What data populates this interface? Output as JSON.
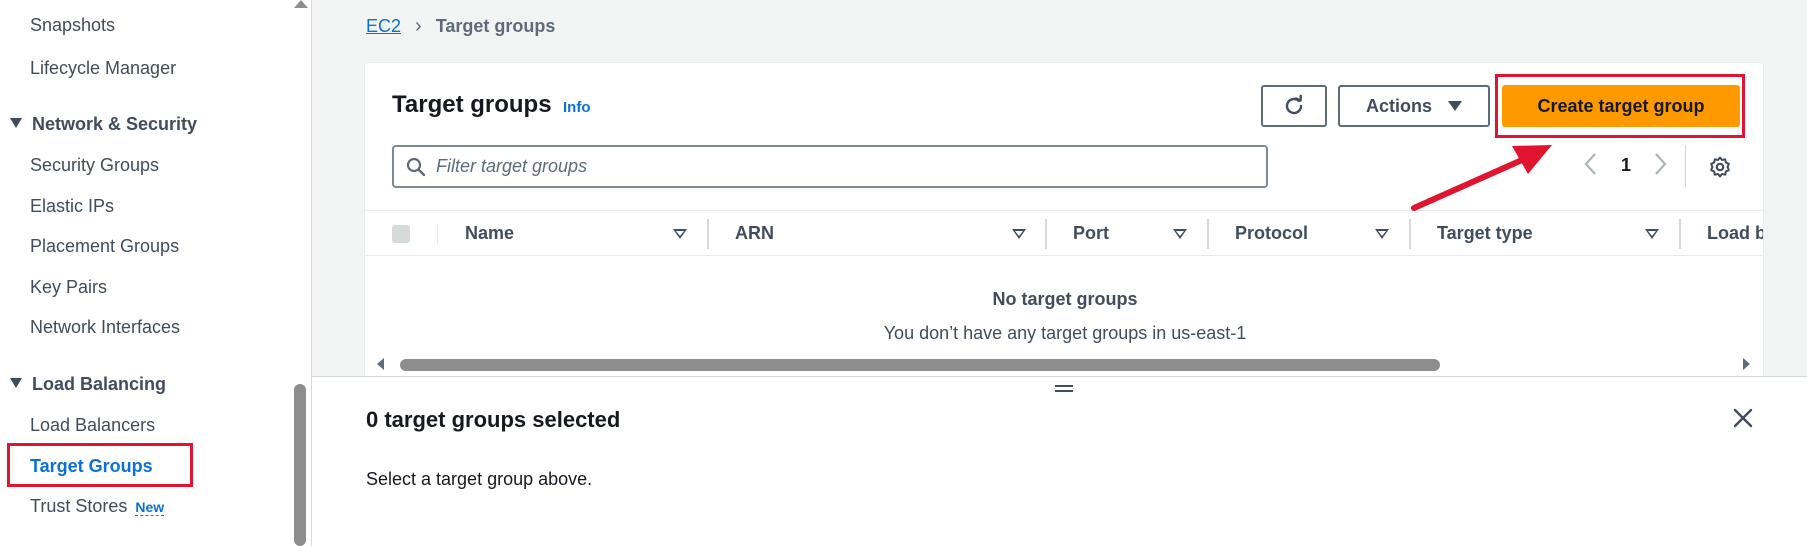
{
  "sidebar": {
    "items_top": [
      "Snapshots",
      "Lifecycle Manager"
    ],
    "network_section": "Network & Security",
    "network_items": [
      "Security Groups",
      "Elastic IPs",
      "Placement Groups",
      "Key Pairs",
      "Network Interfaces"
    ],
    "lb_section": "Load Balancing",
    "lb_items": [
      "Load Balancers",
      "Target Groups",
      "Trust Stores"
    ],
    "new_badge": "New",
    "active_item": "Target Groups"
  },
  "breadcrumb": {
    "root": "EC2",
    "current": "Target groups"
  },
  "panel": {
    "title": "Target groups",
    "info": "Info",
    "actions_label": "Actions",
    "create_label": "Create target group",
    "filter_placeholder": "Filter target groups",
    "page_number": "1",
    "columns": [
      "Name",
      "ARN",
      "Port",
      "Protocol",
      "Target type",
      "Load b"
    ],
    "empty_title": "No target groups",
    "empty_message": "You don’t have any target groups in us-east-1"
  },
  "split_panel": {
    "title": "0 target groups selected",
    "message": "Select a target group above."
  },
  "colors": {
    "primary_button": "#ff9900",
    "link": "#0972d3",
    "highlight": "#e0142f"
  }
}
